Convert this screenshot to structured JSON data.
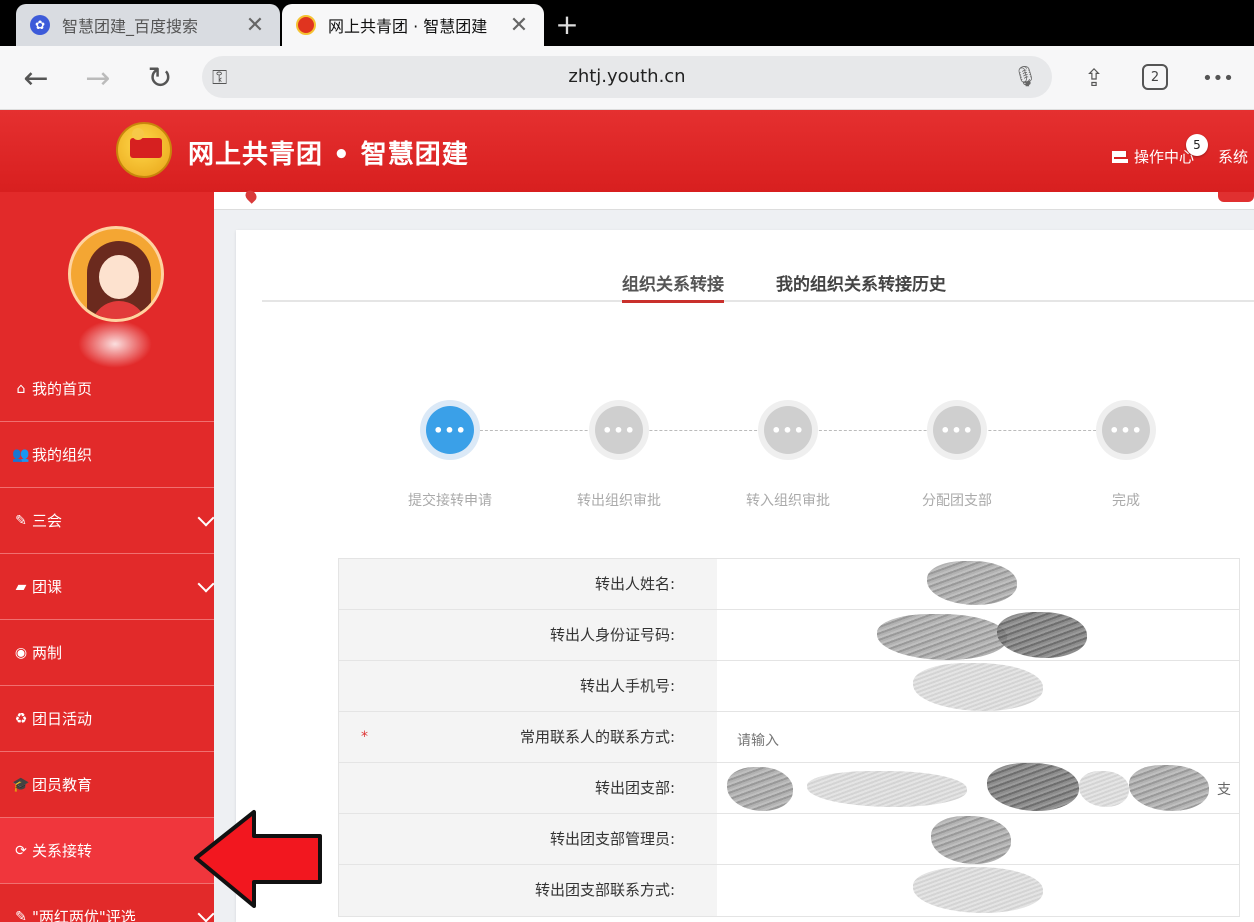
{
  "browser": {
    "tabs": [
      {
        "title": "智慧团建_百度搜索",
        "active": false,
        "favicon": "baidu-paw-icon"
      },
      {
        "title": "网上共青团 · 智慧团建",
        "active": true,
        "favicon": "youth-league-emblem-icon"
      }
    ],
    "close_glyph": "✕",
    "new_tab_glyph": "+",
    "url": "zhtj.youth.cn",
    "tab_count": "2",
    "icons": {
      "back": "←",
      "forward": "→",
      "reload": "↻",
      "key": "⚿",
      "mic": "🎙",
      "share": "⇪",
      "more": "•••"
    }
  },
  "site": {
    "title": "网上共青团 • 智慧团建",
    "ops_label": "操作中心",
    "ops_badge": "5",
    "sys_label": "系统",
    "accent": "#d82222"
  },
  "sidebar": {
    "items": [
      {
        "icon": "home-icon",
        "glyph": "⌂",
        "label": "我的首页",
        "expandable": false
      },
      {
        "icon": "users-icon",
        "glyph": "👥",
        "label": "我的组织",
        "expandable": false
      },
      {
        "icon": "edit-icon",
        "glyph": "✎",
        "label": "三会",
        "expandable": true
      },
      {
        "icon": "folder-open-icon",
        "glyph": "▰",
        "label": "团课",
        "expandable": true
      },
      {
        "icon": "dot-circle-icon",
        "glyph": "◉",
        "label": "两制",
        "expandable": false
      },
      {
        "icon": "recycle-icon",
        "glyph": "♻",
        "label": "团日活动",
        "expandable": false
      },
      {
        "icon": "graduation-cap-icon",
        "glyph": "🎓",
        "label": "团员教育",
        "expandable": false
      },
      {
        "icon": "refresh-icon",
        "glyph": "⟳",
        "label": "关系接转",
        "expandable": false,
        "active": true
      },
      {
        "icon": "edit-icon",
        "glyph": "✎",
        "label": "\"两红两优\"评选",
        "expandable": true
      }
    ]
  },
  "main": {
    "tabs": [
      {
        "label": "组织关系转接",
        "active": true
      },
      {
        "label": "我的组织关系转接历史",
        "active": false
      }
    ],
    "steps": [
      {
        "label": "提交接转申请",
        "glyph": "•••",
        "active": true
      },
      {
        "label": "转出组织审批",
        "glyph": "•••",
        "active": false
      },
      {
        "label": "转入组织审批",
        "glyph": "•••",
        "active": false
      },
      {
        "label": "分配团支部",
        "glyph": "•••",
        "active": false
      },
      {
        "label": "完成",
        "glyph": "•••",
        "active": false
      }
    ],
    "form": {
      "required_mark": "*",
      "rows": [
        {
          "label": "转出人姓名:"
        },
        {
          "label": "转出人身份证号码:"
        },
        {
          "label": "转出人手机号:"
        },
        {
          "label": "常用联系人的联系方式:",
          "required": true,
          "placeholder": "请输入"
        },
        {
          "label": "转出团支部:",
          "trailing": "支"
        },
        {
          "label": "转出团支部管理员:"
        },
        {
          "label": "转出团支部联系方式:"
        }
      ]
    }
  }
}
